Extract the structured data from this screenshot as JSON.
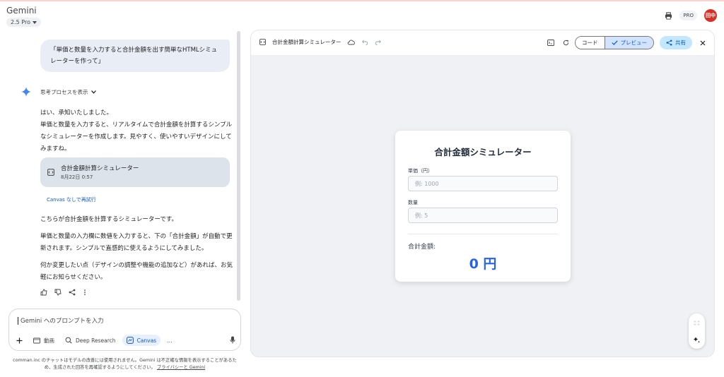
{
  "app": {
    "title": "Gemini",
    "model": "2.5 Pro",
    "pro_badge": "PRO",
    "avatar": "田中"
  },
  "chat": {
    "user_message": "「単価と数量を入力すると合計金額を出す簡単なHTMLシミュレーターを作って」",
    "show_thinking": "思考プロセスを表示",
    "response_intro_1": "はい、承知いたしました。",
    "response_intro_2": "単価と数量を入力すると、リアルタイムで合計金額を計算するシンプルなシミュレーターを作成します。見やすく、使いやすいデザインにしてみますね。",
    "canvas_card": {
      "title": "合計金額計算シミュレーター",
      "date": "8月22日 0:57"
    },
    "canvas_link": "Canvas なしで再試行",
    "response_p1": "こちらが合計金額を計算するシミュレーターです。",
    "response_p2": "単価と数量の入力欄に数値を入力すると、下の「合計金額」が自動で更新されます。シンプルで直感的に使えるようにしてみました。",
    "response_p3": "何か変更したい点（デザインの調整や機能の追加など）があれば、お気軽にお知らせください。"
  },
  "input": {
    "placeholder": "Gemini へのプロンプトを入力",
    "tools": {
      "video": "動画",
      "deep_research": "Deep Research",
      "canvas": "Canvas",
      "more": "…"
    }
  },
  "footnote": {
    "text": "comman.inc のチャットはモデルの改善には使用されません。Gemini は不正確な情報を表示することがあるため、生成された回答を再確認するようにしてください。",
    "link": "プライバシーと Gemini"
  },
  "canvas": {
    "doc_title": "合計金額計算シミュレーター",
    "code_tab": "コード",
    "preview_tab": "プレビュー",
    "share_label": "共有"
  },
  "simulator": {
    "title": "合計金額シミュレーター",
    "unit_price_label": "単価（円）",
    "unit_price_placeholder": "例: 1000",
    "quantity_label": "数量",
    "quantity_placeholder": "例: 5",
    "total_label": "合計金額:",
    "total_value": "0 円"
  },
  "colors": {
    "accent": "#0b57d0",
    "total_blue": "#2563eb",
    "avatar_red": "#d93025"
  }
}
